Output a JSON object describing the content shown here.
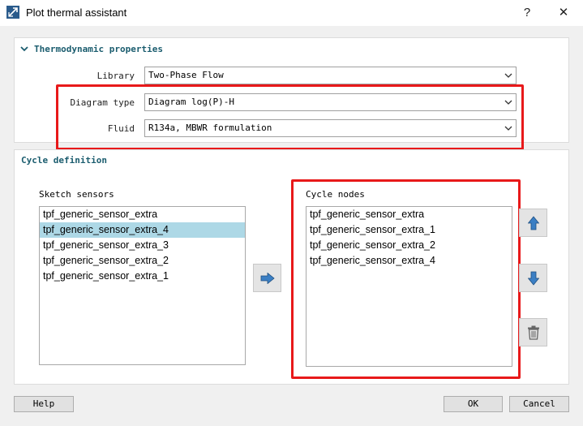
{
  "window": {
    "title": "Plot thermal assistant",
    "help_glyph": "?",
    "close_glyph": "✕"
  },
  "thermo": {
    "title": "Thermodynamic properties",
    "library_label": "Library",
    "library_value": "Two-Phase Flow",
    "diagram_type_label": "Diagram type",
    "diagram_type_value": "Diagram log(P)-H",
    "fluid_label": "Fluid",
    "fluid_value": "R134a, MBWR formulation"
  },
  "cycle": {
    "title": "Cycle definition",
    "sketch_sensors_label": "Sketch sensors",
    "sketch_sensors": [
      "tpf_generic_sensor_extra",
      "tpf_generic_sensor_extra_4",
      "tpf_generic_sensor_extra_3",
      "tpf_generic_sensor_extra_2",
      "tpf_generic_sensor_extra_1"
    ],
    "selected_sensor_index": 1,
    "cycle_nodes_label": "Cycle nodes",
    "cycle_nodes": [
      "tpf_generic_sensor_extra",
      "tpf_generic_sensor_extra_1",
      "tpf_generic_sensor_extra_2",
      "tpf_generic_sensor_extra_4"
    ]
  },
  "buttons": {
    "help": "Help",
    "ok": "OK",
    "cancel": "Cancel"
  },
  "colors": {
    "accent": "#1a5c6e",
    "highlight": "#e8191a",
    "selection": "#add8e6",
    "arrow": "#3b7fc4"
  },
  "icons": {
    "add": "arrow-right-icon",
    "up": "arrow-up-icon",
    "down": "arrow-down-icon",
    "delete": "trash-icon"
  }
}
